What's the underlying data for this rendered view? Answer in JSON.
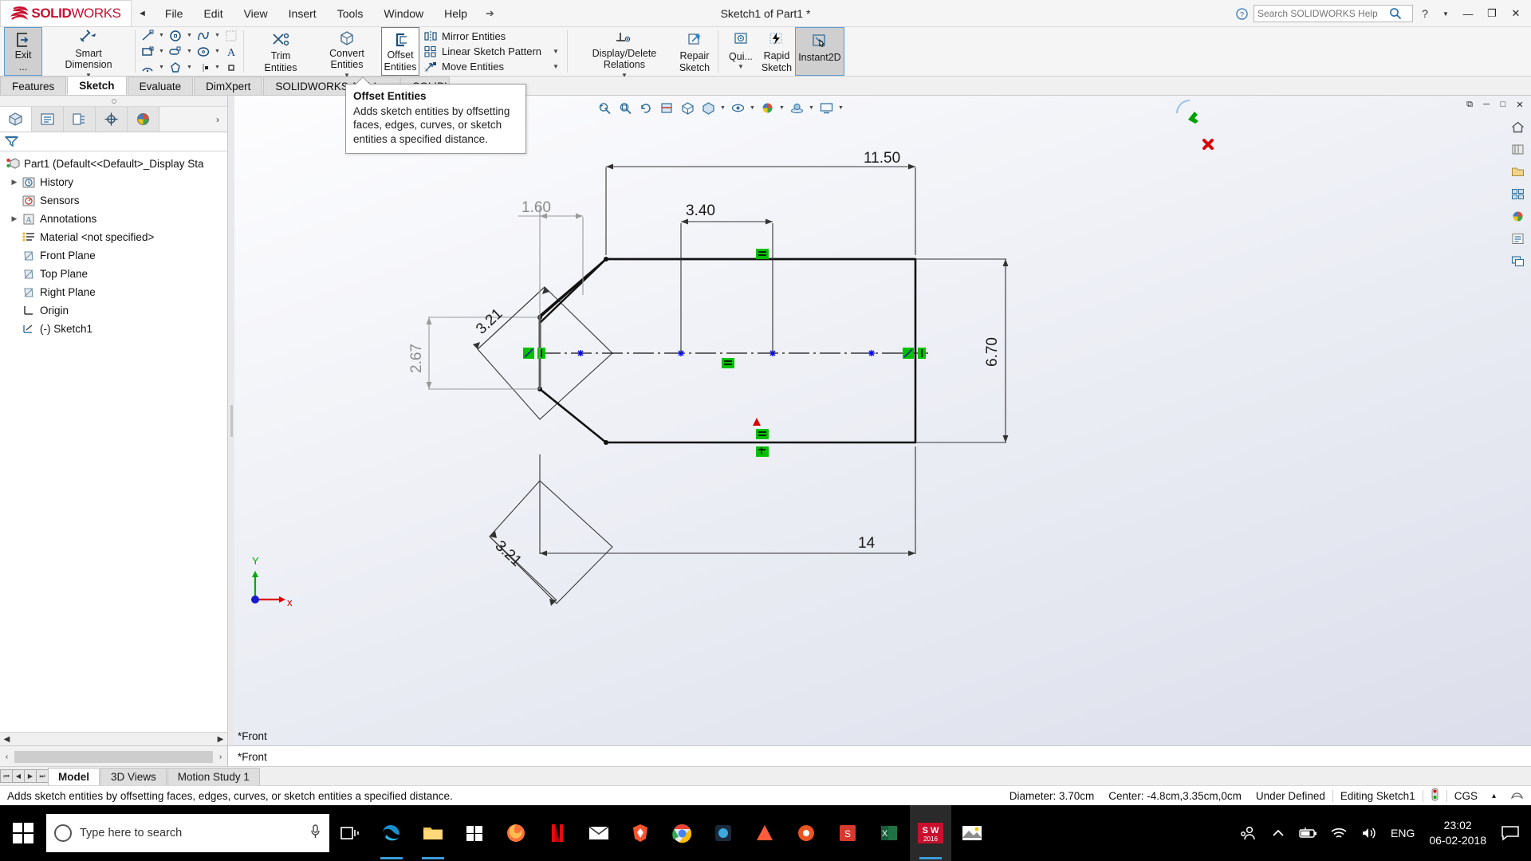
{
  "titlebar": {
    "logo": {
      "ds": "2S",
      "solid": "SOLID",
      "works": "WORKS"
    },
    "menu": [
      "File",
      "Edit",
      "View",
      "Insert",
      "Tools",
      "Window",
      "Help"
    ],
    "document_title": "Sketch1 of Part1 *",
    "search_placeholder": "Search SOLIDWORKS Help",
    "help_label": "?",
    "minimize": "—",
    "maximize": "❐",
    "close": "✕"
  },
  "ribbon": {
    "exit_sketch": "Exit ...",
    "smart_dimension": "Smart Dimension",
    "trim_entities": "Trim Entities",
    "convert_entities": "Convert Entities",
    "offset_entities_line1": "Offset",
    "offset_entities_line2": "Entities",
    "mirror_entities": "Mirror Entities",
    "linear_sketch_pattern": "Linear Sketch Pattern",
    "move_entities": "Move Entities",
    "display_delete_relations": "Display/Delete Relations",
    "repair_sketch_line1": "Repair",
    "repair_sketch_line2": "Sketch",
    "quick_snaps": "Qui...",
    "rapid_sketch_line1": "Rapid",
    "rapid_sketch_line2": "Sketch",
    "instant2d": "Instant2D"
  },
  "command_tabs": [
    {
      "label": "Features",
      "active": false
    },
    {
      "label": "Sketch",
      "active": true
    },
    {
      "label": "Evaluate",
      "active": false
    },
    {
      "label": "DimXpert",
      "active": false
    },
    {
      "label": "SOLIDWORKS Add-Ins",
      "active": false
    },
    {
      "label": "SOLIDW",
      "active": false
    }
  ],
  "tooltip": {
    "title": "Offset Entities",
    "body": "Adds sketch entities by offsetting faces, edges, curves, or sketch entities a specified distance."
  },
  "feature_tree": {
    "tabs": [
      "feature-manager-tab",
      "property-manager-tab",
      "configuration-manager-tab",
      "dimxpert-manager-tab",
      "display-manager-tab"
    ],
    "filter_placeholder": "",
    "items": [
      {
        "label": "Part1  (Default<<Default>_Display Sta",
        "icon": "part-icon",
        "arrow": false,
        "indent": 0
      },
      {
        "label": "History",
        "icon": "history-icon",
        "arrow": true,
        "indent": 1
      },
      {
        "label": "Sensors",
        "icon": "sensors-icon",
        "arrow": false,
        "indent": 1
      },
      {
        "label": "Annotations",
        "icon": "annotations-icon",
        "arrow": true,
        "indent": 1
      },
      {
        "label": "Material <not specified>",
        "icon": "material-icon",
        "arrow": false,
        "indent": 1
      },
      {
        "label": "Front Plane",
        "icon": "plane-icon",
        "arrow": false,
        "indent": 1
      },
      {
        "label": "Top Plane",
        "icon": "plane-icon",
        "arrow": false,
        "indent": 1
      },
      {
        "label": "Right Plane",
        "icon": "plane-icon",
        "arrow": false,
        "indent": 1
      },
      {
        "label": "Origin",
        "icon": "origin-icon",
        "arrow": false,
        "indent": 1
      },
      {
        "label": "(-) Sketch1",
        "icon": "sketch-icon",
        "arrow": false,
        "indent": 1
      }
    ]
  },
  "graphics": {
    "view_label": "*Front",
    "origin_axis_x": "x",
    "origin_axis_y": "Y"
  },
  "sketch_dimensions": {
    "top_width": "11.50",
    "inner_width": "3.40",
    "bottom_width": "14",
    "height_right": "6.70",
    "height_left": "2.67",
    "diag_top": "3.21",
    "diag_bottom": "3.21",
    "offset_width": "1.60"
  },
  "bottom": {
    "sheet_view": "*Front",
    "tabs": [
      {
        "label": "Model",
        "active": true
      },
      {
        "label": "3D Views",
        "active": false
      },
      {
        "label": "Motion Study 1",
        "active": false
      }
    ],
    "status_message": "Adds sketch entities by offsetting faces, edges, curves, or sketch entities a specified distance.",
    "status_diameter": "Diameter: 3.70cm",
    "status_center": "Center: -4.8cm,3.35cm,0cm",
    "status_defined": "Under Defined",
    "status_editing": "Editing Sketch1",
    "status_units": "CGS",
    "status_units_caret": "▴"
  },
  "taskbar": {
    "search_placeholder": "Type here to search",
    "language": "ENG",
    "clock_time": "23:02",
    "clock_date": "06-02-2018",
    "apps": [
      "task-view-icon",
      "edge-icon",
      "file-explorer-icon",
      "store-icon",
      "firefox-icon",
      "netflix-icon",
      "mail-icon",
      "brave-icon",
      "chrome-icon",
      "camtasia-icon",
      "autodesk-icon",
      "ubuntu-icon",
      "sldworks-red-icon",
      "excel-icon",
      "solidworks-icon",
      "photos-icon"
    ]
  },
  "colors": {
    "accent": "#c8102e",
    "ribbon_bg": "#f5f5f5",
    "selected_blue": "#5b9bd5",
    "relation_green": "#00c000",
    "construction_blue": "#0000ff",
    "dim_gray": "#8a8a8a"
  }
}
